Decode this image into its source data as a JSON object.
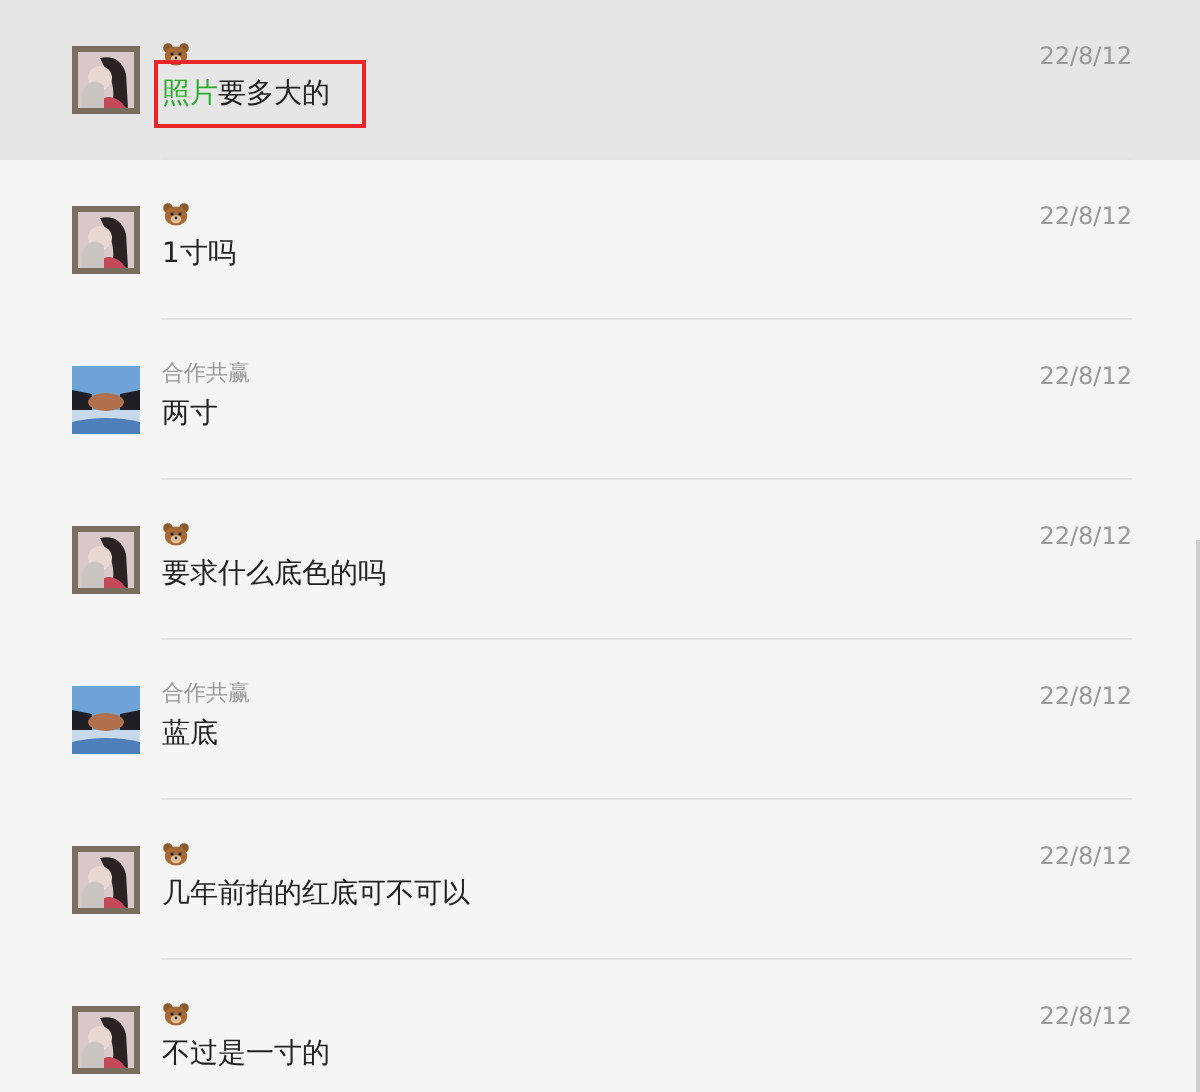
{
  "messages": [
    {
      "kind": "bear",
      "match": "照片",
      "text": "要多大的",
      "date": "22/8/12",
      "selected": true,
      "outlined": true
    },
    {
      "kind": "bear",
      "text": "1寸吗",
      "date": "22/8/12",
      "selected": false,
      "outlined": false
    },
    {
      "kind": "named",
      "sender": "合作共赢",
      "text": "两寸",
      "date": "22/8/12",
      "selected": false,
      "outlined": false
    },
    {
      "kind": "bear",
      "text": "要求什么底色的吗",
      "date": "22/8/12",
      "selected": false,
      "outlined": false
    },
    {
      "kind": "named",
      "sender": "合作共赢",
      "text": "蓝底",
      "date": "22/8/12",
      "selected": false,
      "outlined": false
    },
    {
      "kind": "bear",
      "text": "几年前拍的红底可不可以",
      "date": "22/8/12",
      "selected": false,
      "outlined": false
    },
    {
      "kind": "bear",
      "text": "不过是一寸的",
      "date": "22/8/12",
      "selected": false,
      "outlined": false
    }
  ]
}
